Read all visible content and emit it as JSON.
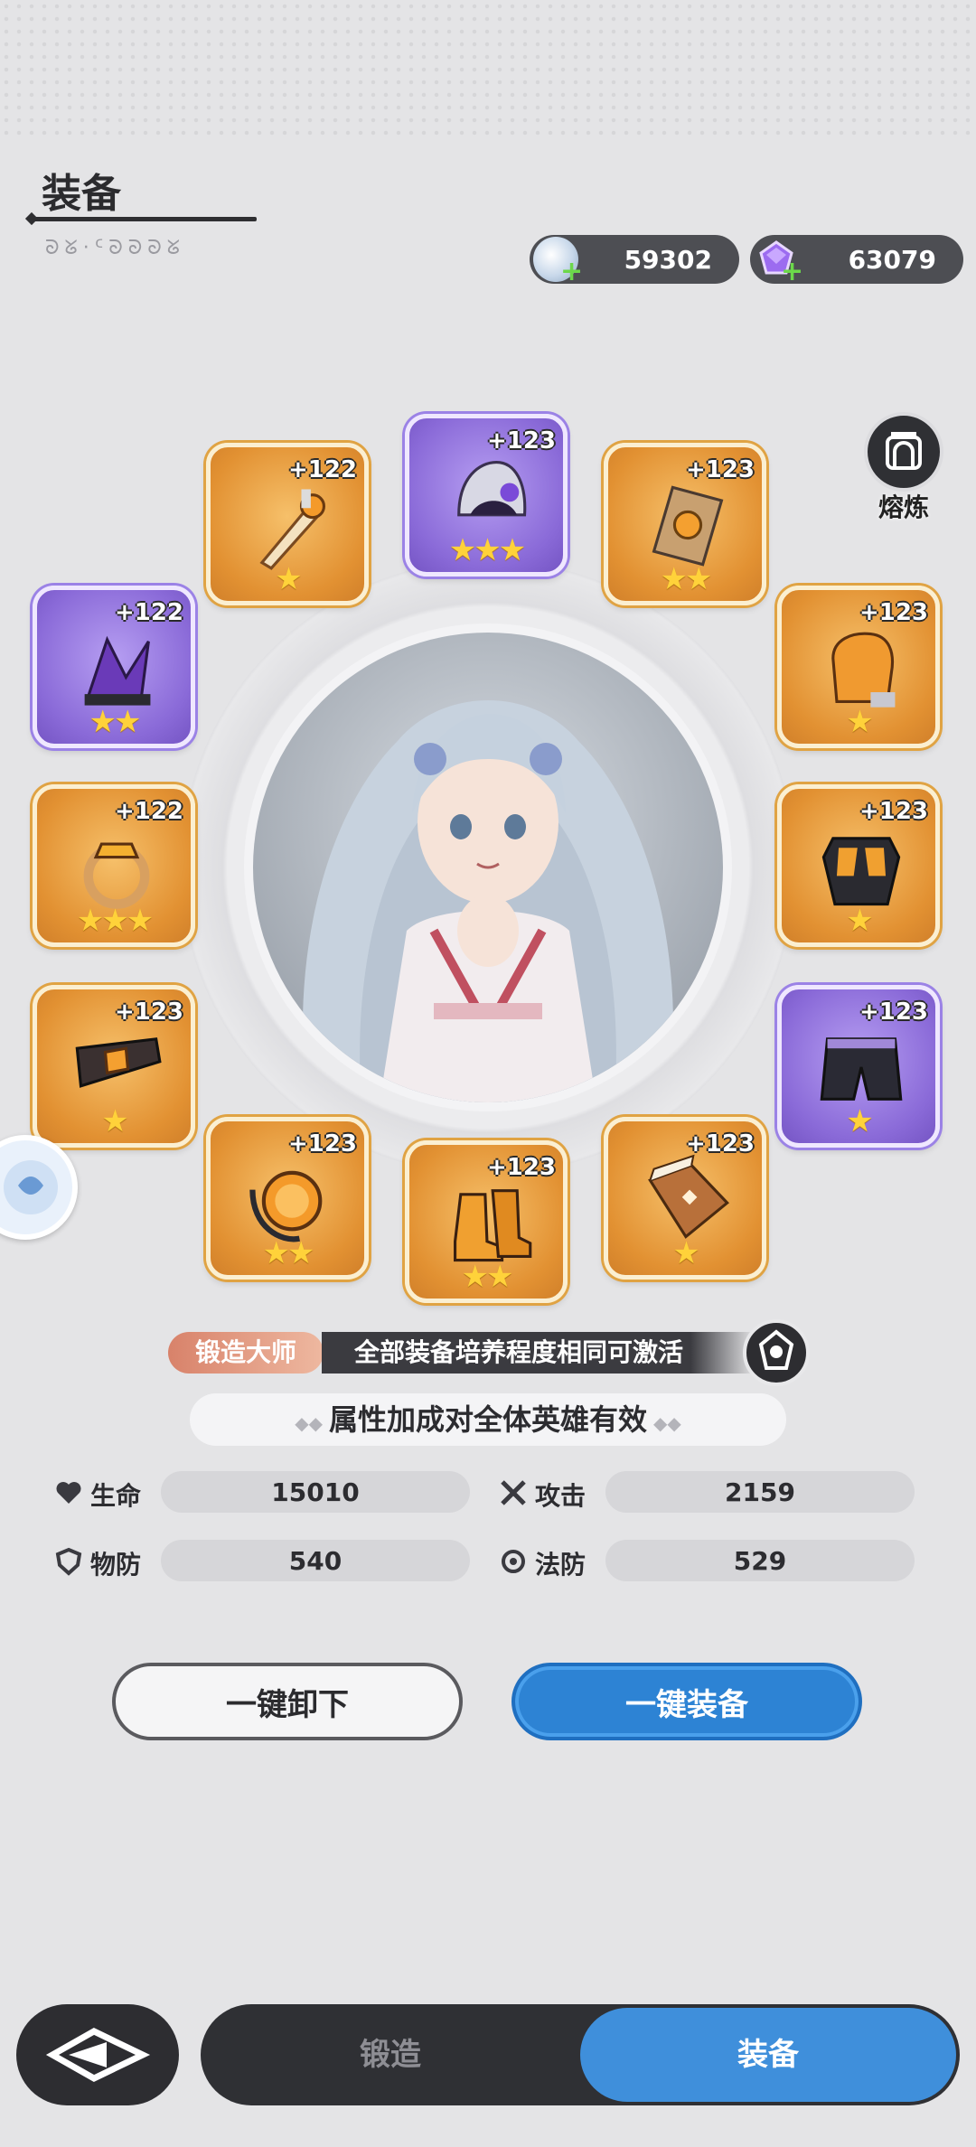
{
  "header": {
    "title": "装备",
    "subtitle_glyphs": "ᘐᘜ·ᑦᘐᘐᘐᘜ"
  },
  "currencies": [
    {
      "name": "silver-coin",
      "value": "59302"
    },
    {
      "name": "purple-gem",
      "value": "63079"
    }
  ],
  "smelt": {
    "label": "熔炼"
  },
  "slots": [
    {
      "name": "sword",
      "level": "+122",
      "stars": "★",
      "rarity": "gold"
    },
    {
      "name": "helmet",
      "level": "+123",
      "stars": "★★★",
      "rarity": "purple"
    },
    {
      "name": "shield",
      "level": "+123",
      "stars": "★★",
      "rarity": "gold"
    },
    {
      "name": "headpiece",
      "level": "+122",
      "stars": "★★",
      "rarity": "purple"
    },
    {
      "name": "gauntlet",
      "level": "+123",
      "stars": "★",
      "rarity": "gold"
    },
    {
      "name": "ring",
      "level": "+122",
      "stars": "★★★",
      "rarity": "gold"
    },
    {
      "name": "chestplate",
      "level": "+123",
      "stars": "★",
      "rarity": "gold"
    },
    {
      "name": "belt",
      "level": "+123",
      "stars": "★",
      "rarity": "gold"
    },
    {
      "name": "shorts",
      "level": "+123",
      "stars": "★",
      "rarity": "purple"
    },
    {
      "name": "amulet",
      "level": "+123",
      "stars": "★★",
      "rarity": "gold"
    },
    {
      "name": "boots",
      "level": "+123",
      "stars": "★★",
      "rarity": "gold"
    },
    {
      "name": "book",
      "level": "+123",
      "stars": "★",
      "rarity": "gold"
    }
  ],
  "master": {
    "badge": "锻造大师",
    "text": "全部装备培养程度相同可激活"
  },
  "bonus": {
    "text": "属性加成对全体英雄有效"
  },
  "stats": {
    "hp": {
      "label": "生命",
      "value": "15010"
    },
    "atk": {
      "label": "攻击",
      "value": "2159"
    },
    "pdef": {
      "label": "物防",
      "value": "540"
    },
    "mdef": {
      "label": "法防",
      "value": "529"
    }
  },
  "buttons": {
    "unequip": "一键卸下",
    "equip": "一键装备"
  },
  "tabs": {
    "forge": "锻造",
    "equip": "装备"
  }
}
